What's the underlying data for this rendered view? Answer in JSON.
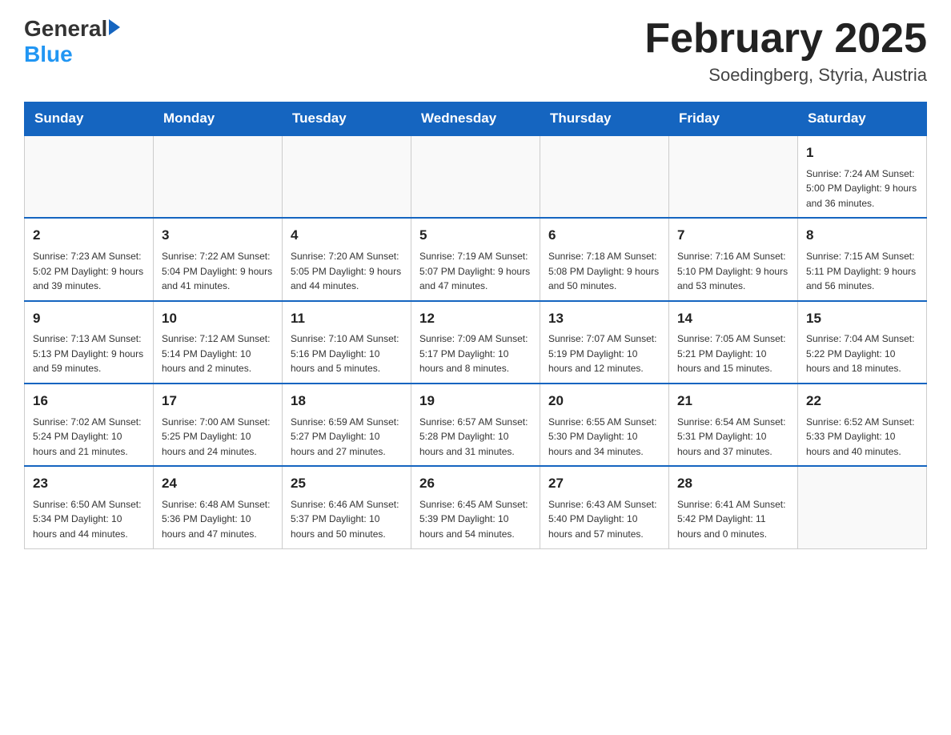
{
  "header": {
    "logo_general": "General",
    "logo_blue": "Blue",
    "month_title": "February 2025",
    "location": "Soedingberg, Styria, Austria"
  },
  "weekdays": [
    "Sunday",
    "Monday",
    "Tuesday",
    "Wednesday",
    "Thursday",
    "Friday",
    "Saturday"
  ],
  "weeks": [
    [
      {
        "day": "",
        "info": ""
      },
      {
        "day": "",
        "info": ""
      },
      {
        "day": "",
        "info": ""
      },
      {
        "day": "",
        "info": ""
      },
      {
        "day": "",
        "info": ""
      },
      {
        "day": "",
        "info": ""
      },
      {
        "day": "1",
        "info": "Sunrise: 7:24 AM\nSunset: 5:00 PM\nDaylight: 9 hours\nand 36 minutes."
      }
    ],
    [
      {
        "day": "2",
        "info": "Sunrise: 7:23 AM\nSunset: 5:02 PM\nDaylight: 9 hours\nand 39 minutes."
      },
      {
        "day": "3",
        "info": "Sunrise: 7:22 AM\nSunset: 5:04 PM\nDaylight: 9 hours\nand 41 minutes."
      },
      {
        "day": "4",
        "info": "Sunrise: 7:20 AM\nSunset: 5:05 PM\nDaylight: 9 hours\nand 44 minutes."
      },
      {
        "day": "5",
        "info": "Sunrise: 7:19 AM\nSunset: 5:07 PM\nDaylight: 9 hours\nand 47 minutes."
      },
      {
        "day": "6",
        "info": "Sunrise: 7:18 AM\nSunset: 5:08 PM\nDaylight: 9 hours\nand 50 minutes."
      },
      {
        "day": "7",
        "info": "Sunrise: 7:16 AM\nSunset: 5:10 PM\nDaylight: 9 hours\nand 53 minutes."
      },
      {
        "day": "8",
        "info": "Sunrise: 7:15 AM\nSunset: 5:11 PM\nDaylight: 9 hours\nand 56 minutes."
      }
    ],
    [
      {
        "day": "9",
        "info": "Sunrise: 7:13 AM\nSunset: 5:13 PM\nDaylight: 9 hours\nand 59 minutes."
      },
      {
        "day": "10",
        "info": "Sunrise: 7:12 AM\nSunset: 5:14 PM\nDaylight: 10 hours\nand 2 minutes."
      },
      {
        "day": "11",
        "info": "Sunrise: 7:10 AM\nSunset: 5:16 PM\nDaylight: 10 hours\nand 5 minutes."
      },
      {
        "day": "12",
        "info": "Sunrise: 7:09 AM\nSunset: 5:17 PM\nDaylight: 10 hours\nand 8 minutes."
      },
      {
        "day": "13",
        "info": "Sunrise: 7:07 AM\nSunset: 5:19 PM\nDaylight: 10 hours\nand 12 minutes."
      },
      {
        "day": "14",
        "info": "Sunrise: 7:05 AM\nSunset: 5:21 PM\nDaylight: 10 hours\nand 15 minutes."
      },
      {
        "day": "15",
        "info": "Sunrise: 7:04 AM\nSunset: 5:22 PM\nDaylight: 10 hours\nand 18 minutes."
      }
    ],
    [
      {
        "day": "16",
        "info": "Sunrise: 7:02 AM\nSunset: 5:24 PM\nDaylight: 10 hours\nand 21 minutes."
      },
      {
        "day": "17",
        "info": "Sunrise: 7:00 AM\nSunset: 5:25 PM\nDaylight: 10 hours\nand 24 minutes."
      },
      {
        "day": "18",
        "info": "Sunrise: 6:59 AM\nSunset: 5:27 PM\nDaylight: 10 hours\nand 27 minutes."
      },
      {
        "day": "19",
        "info": "Sunrise: 6:57 AM\nSunset: 5:28 PM\nDaylight: 10 hours\nand 31 minutes."
      },
      {
        "day": "20",
        "info": "Sunrise: 6:55 AM\nSunset: 5:30 PM\nDaylight: 10 hours\nand 34 minutes."
      },
      {
        "day": "21",
        "info": "Sunrise: 6:54 AM\nSunset: 5:31 PM\nDaylight: 10 hours\nand 37 minutes."
      },
      {
        "day": "22",
        "info": "Sunrise: 6:52 AM\nSunset: 5:33 PM\nDaylight: 10 hours\nand 40 minutes."
      }
    ],
    [
      {
        "day": "23",
        "info": "Sunrise: 6:50 AM\nSunset: 5:34 PM\nDaylight: 10 hours\nand 44 minutes."
      },
      {
        "day": "24",
        "info": "Sunrise: 6:48 AM\nSunset: 5:36 PM\nDaylight: 10 hours\nand 47 minutes."
      },
      {
        "day": "25",
        "info": "Sunrise: 6:46 AM\nSunset: 5:37 PM\nDaylight: 10 hours\nand 50 minutes."
      },
      {
        "day": "26",
        "info": "Sunrise: 6:45 AM\nSunset: 5:39 PM\nDaylight: 10 hours\nand 54 minutes."
      },
      {
        "day": "27",
        "info": "Sunrise: 6:43 AM\nSunset: 5:40 PM\nDaylight: 10 hours\nand 57 minutes."
      },
      {
        "day": "28",
        "info": "Sunrise: 6:41 AM\nSunset: 5:42 PM\nDaylight: 11 hours\nand 0 minutes."
      },
      {
        "day": "",
        "info": ""
      }
    ]
  ]
}
